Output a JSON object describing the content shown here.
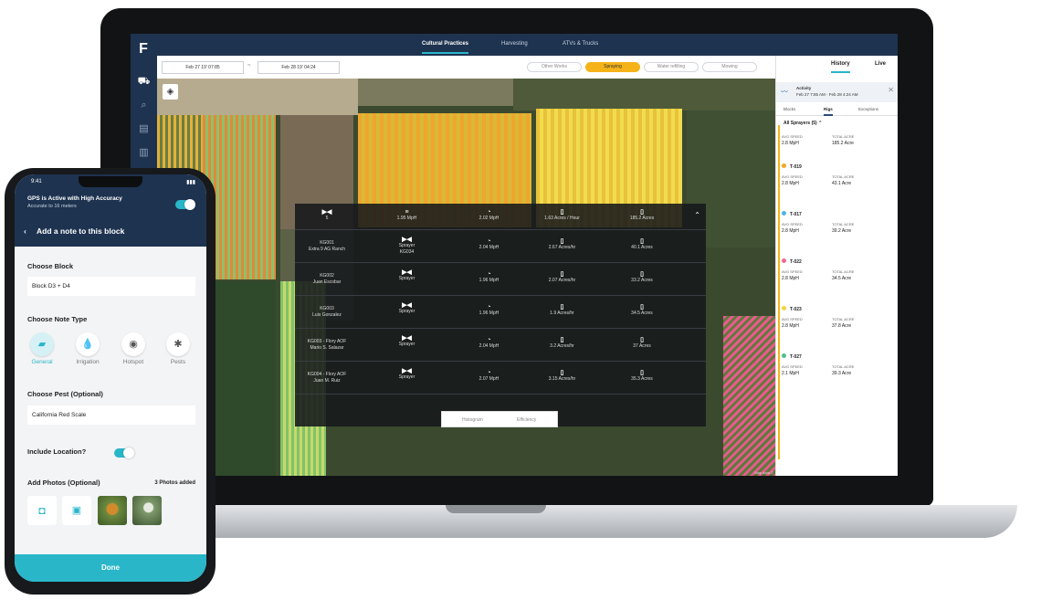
{
  "laptop": {
    "nav_tabs": [
      "Cultural Practices",
      "Harvesting",
      "ATVs & Trucks"
    ],
    "date_from": "Feb 27 19' 07:85",
    "date_separator": "~",
    "date_to": "Feb 28 19' 04:24",
    "filters": [
      "Other Works",
      "Spraying",
      "Water refilling",
      "Mowing"
    ],
    "active_filter": "Spraying",
    "mode_tabs": [
      "History",
      "Live"
    ],
    "activity": {
      "title": "Activity",
      "range": "Feb 27 7:85 AM - Feb 28 4:24 AM"
    },
    "sub_tabs": [
      "Blocks",
      "Rigs",
      "Exceptions"
    ],
    "list_header": "All Sprayers (5)",
    "col_speed": "AVG SPEED",
    "col_acres": "TOTAL ACRE",
    "sprayers": [
      {
        "name": "",
        "speed": "2.8 MpH",
        "acres": "185.2 Acre",
        "color": ""
      },
      {
        "name": "T-019",
        "speed": "2.8 MpH",
        "acres": "43.1 Acre",
        "color": "#f5a623"
      },
      {
        "name": "T-017",
        "speed": "2.8 MpH",
        "acres": "39.2 Acre",
        "color": "#4fb3e8"
      },
      {
        "name": "T-022",
        "speed": "2.8 MpH",
        "acres": "34.5 Acre",
        "color": "#f06b8f"
      },
      {
        "name": "T-023",
        "speed": "2.8 MpH",
        "acres": "37.8 Acre",
        "color": "#f5d33a"
      },
      {
        "name": "T-027",
        "speed": "2.1 MpH",
        "acres": "39.3 Acre",
        "color": "#4fc08d"
      }
    ],
    "overlay": {
      "summary": [
        "5",
        "1.95 MpH",
        "2.02 MpH",
        "1.63 Acres / Hour",
        "185.2 Acres"
      ],
      "rows": [
        {
          "id": "KG001",
          "operator": "Extra 9 AG Ranch",
          "equip": "Sprayer",
          "equip_id": "KG034",
          "speed": "2.04 MpH",
          "rate": "2.67 Acres/hr",
          "acres": "40.1 Acres"
        },
        {
          "id": "KG002",
          "operator": "Juan Escobar",
          "equip": "Sprayer",
          "equip_id": "",
          "speed": "1.96 MpH",
          "rate": "2.07 Acres/hr",
          "acres": "33.2 Acres"
        },
        {
          "id": "KG003",
          "operator": "Luis Gonzalez",
          "equip": "Sprayer",
          "equip_id": "",
          "speed": "1.96 MpH",
          "rate": "1.9 Acres/hr",
          "acres": "34.5 Acres"
        },
        {
          "id": "KG003 - Flory AOF",
          "operator": "Mario S. Salazar",
          "equip": "Sprayer",
          "equip_id": "",
          "speed": "2.04 MpH",
          "rate": "3.2 Acres/hr",
          "acres": "37 Acres"
        },
        {
          "id": "KG004 - Flory AOF",
          "operator": "Juan M. Ruiz",
          "equip": "Sprayer",
          "equip_id": "",
          "speed": "2.07 MpH",
          "rate": "3.15 Acres/hr",
          "acres": "35.3 Acres"
        }
      ],
      "bottom_tabs": [
        "Histogram",
        "Efficiency"
      ]
    }
  },
  "phone": {
    "time": "9:41",
    "gps_title": "GPS is Active with High Accuracy",
    "gps_sub": "Accurate to 16 meters",
    "header": "Add a note to this block",
    "choose_block_label": "Choose Block",
    "block_value": "Block D3 + D4",
    "note_type_label": "Choose Note Type",
    "note_types": [
      "General",
      "Irrigation",
      "Hotspot",
      "Pests"
    ],
    "pest_label": "Choose Pest (Optional)",
    "pest_value": "California Red Scale",
    "location_label": "Include Location?",
    "photos_label": "Add Photos (Optional)",
    "photos_count": "3 Photos added",
    "done": "Done"
  },
  "colors": {
    "navy": "#1e3350",
    "accent": "#2ab6c9",
    "spraying": "#f5b318"
  }
}
